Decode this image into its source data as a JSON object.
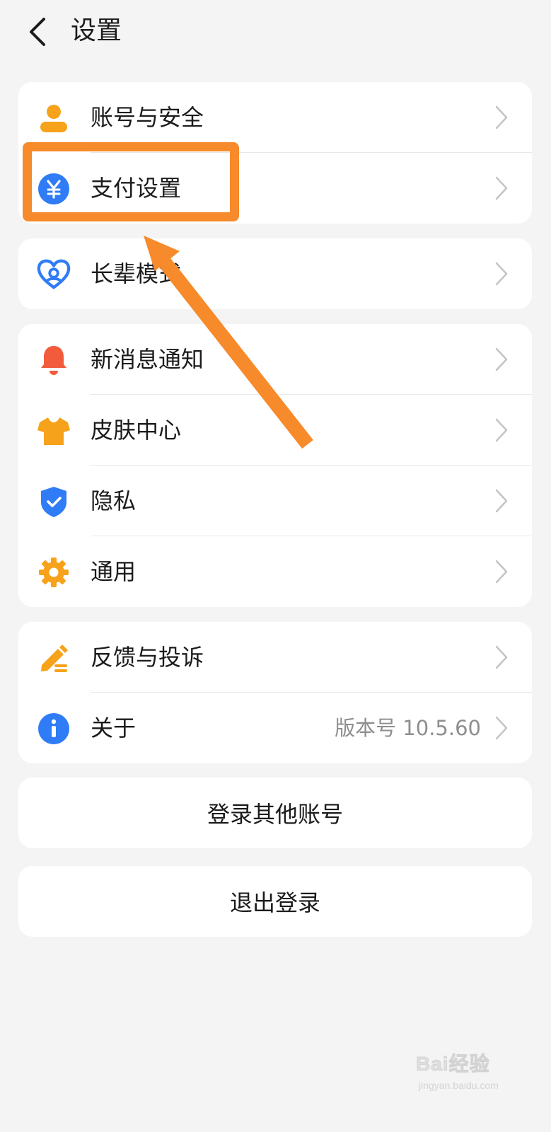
{
  "header": {
    "back_icon": "chevron-left-icon",
    "title": "设置"
  },
  "groups": [
    {
      "items": [
        {
          "label": "账号与安全",
          "icon": "user-icon",
          "icon_color": "#f7a21b"
        },
        {
          "label": "支付设置",
          "icon": "yuan-icon",
          "icon_color": "#2f7cf6"
        }
      ]
    },
    {
      "items": [
        {
          "label": "长辈模式",
          "icon": "heart-care-icon",
          "icon_color": "#2f7cf6"
        }
      ]
    },
    {
      "items": [
        {
          "label": "新消息通知",
          "icon": "bell-icon",
          "icon_color": "#f25b3b"
        },
        {
          "label": "皮肤中心",
          "icon": "tshirt-icon",
          "icon_color": "#f7a21b"
        },
        {
          "label": "隐私",
          "icon": "shield-check-icon",
          "icon_color": "#2f7cf6"
        },
        {
          "label": "通用",
          "icon": "gear-icon",
          "icon_color": "#f7a21b"
        }
      ]
    },
    {
      "items": [
        {
          "label": "反馈与投诉",
          "icon": "pencil-icon",
          "icon_color": "#f7a21b"
        },
        {
          "label": "关于",
          "icon": "info-icon",
          "icon_color": "#2f7cf6",
          "value": "版本号 10.5.60"
        }
      ]
    }
  ],
  "actions": {
    "switch_account": "登录其他账号",
    "logout": "退出登录"
  },
  "annotation": {
    "highlight_color": "#f78a2a",
    "target": "支付设置"
  },
  "watermark": {
    "brand": "Bai经验",
    "url": "jingyan.baidu.com"
  }
}
